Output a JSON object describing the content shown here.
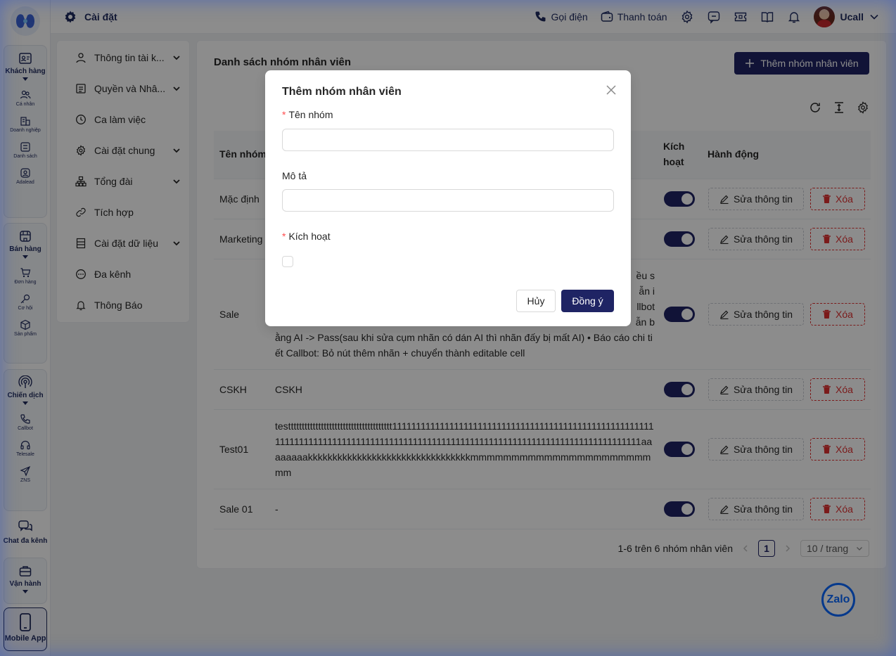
{
  "sidebar": {
    "groups": [
      {
        "label": "Khách hàng",
        "items": [
          "Cá nhân",
          "Doanh nghiệp",
          "Danh sách",
          "Adalead"
        ]
      },
      {
        "label": "Bán hàng",
        "items": [
          "Đơn hàng",
          "Cơ hội",
          "Sản phẩm"
        ]
      },
      {
        "label": "Chiến dịch",
        "items": [
          "Callbot",
          "Telesale",
          "ZNS"
        ]
      }
    ],
    "chat": "Chat đa kênh",
    "operation": "Vận hành",
    "mobile": "Mobile App"
  },
  "header": {
    "title": "Cài đặt",
    "call": "Gọi điện",
    "payment": "Thanh toán",
    "user": "Ucall"
  },
  "settings_menu": [
    {
      "label": "Thông tin tài k...",
      "icon": "user-icon",
      "chevron": true
    },
    {
      "label": "Quyền và Nhâ...",
      "icon": "document-icon",
      "chevron": true
    },
    {
      "label": "Ca làm việc",
      "icon": "clock-icon",
      "chevron": false
    },
    {
      "label": "Cài đặt chung",
      "icon": "gear-icon",
      "chevron": true
    },
    {
      "label": "Tổng đài",
      "icon": "switchboard-icon",
      "chevron": true
    },
    {
      "label": "Tích hợp",
      "icon": "link-icon",
      "chevron": false
    },
    {
      "label": "Cài đặt dữ liệu",
      "icon": "database-icon",
      "chevron": true
    },
    {
      "label": "Đa kênh",
      "icon": "chat-icon",
      "chevron": false
    },
    {
      "label": "Thông Báo",
      "icon": "bell-icon",
      "chevron": false
    }
  ],
  "main": {
    "title": "Danh sách nhóm nhân viên",
    "add_button": "Thêm nhóm nhân viên",
    "columns": {
      "name": "Tên nhóm",
      "active_1": "Kích",
      "active_2": "hoạt",
      "actions": "Hành động"
    },
    "edit_label": "Sửa thông tin",
    "delete_label": "Xóa",
    "rows": [
      {
        "name": "Mặc định",
        "description": "",
        "active": true
      },
      {
        "name": "Marketing",
        "description": "",
        "active": true
      },
      {
        "name": "Sale",
        "description": "ều s|ẫn i|llbot|ẫn b|ằng AI  -> Pass(sau khi sửa cụm nhãn có dán AI thì nhãn đấy bị mất AI) •   Báo cáo chi tiết Callbot: Bỏ nút thêm nhãn + chuyển thành editable cell",
        "active": true
      },
      {
        "name": "CSKH",
        "description": "CSKH",
        "active": true
      },
      {
        "name": "Test01",
        "description": "testttttttttttttttttttttttttttttttttttttt111111111111111111111111111111111111111111111111111111111111111111111111111111111111111111111111111111111111111111111111111111111111aaaaaaaakkkkkkkkkkkkkkkkkkkkkkkkkkkkkkkkkmmmmmmmmmmmmmmmmmmmmmmmm",
        "active": true
      },
      {
        "name": "Sale 01",
        "description": "-",
        "active": true
      }
    ],
    "pagination": {
      "summary": "1-6 trên 6 nhóm nhân viên",
      "page": "1",
      "page_size": "10 / trang"
    }
  },
  "zalo": "Zalo",
  "modal": {
    "title": "Thêm nhóm nhân viên",
    "name_label": "Tên nhóm",
    "name_value": "",
    "description_label": "Mô tả",
    "description_value": "",
    "active_label": "Kích hoạt",
    "active_checked": false,
    "cancel": "Hủy",
    "ok": "Đồng ý"
  },
  "colors": {
    "primary": "#1f2464",
    "danger": "#e03131",
    "zalo": "#0a68ff"
  }
}
